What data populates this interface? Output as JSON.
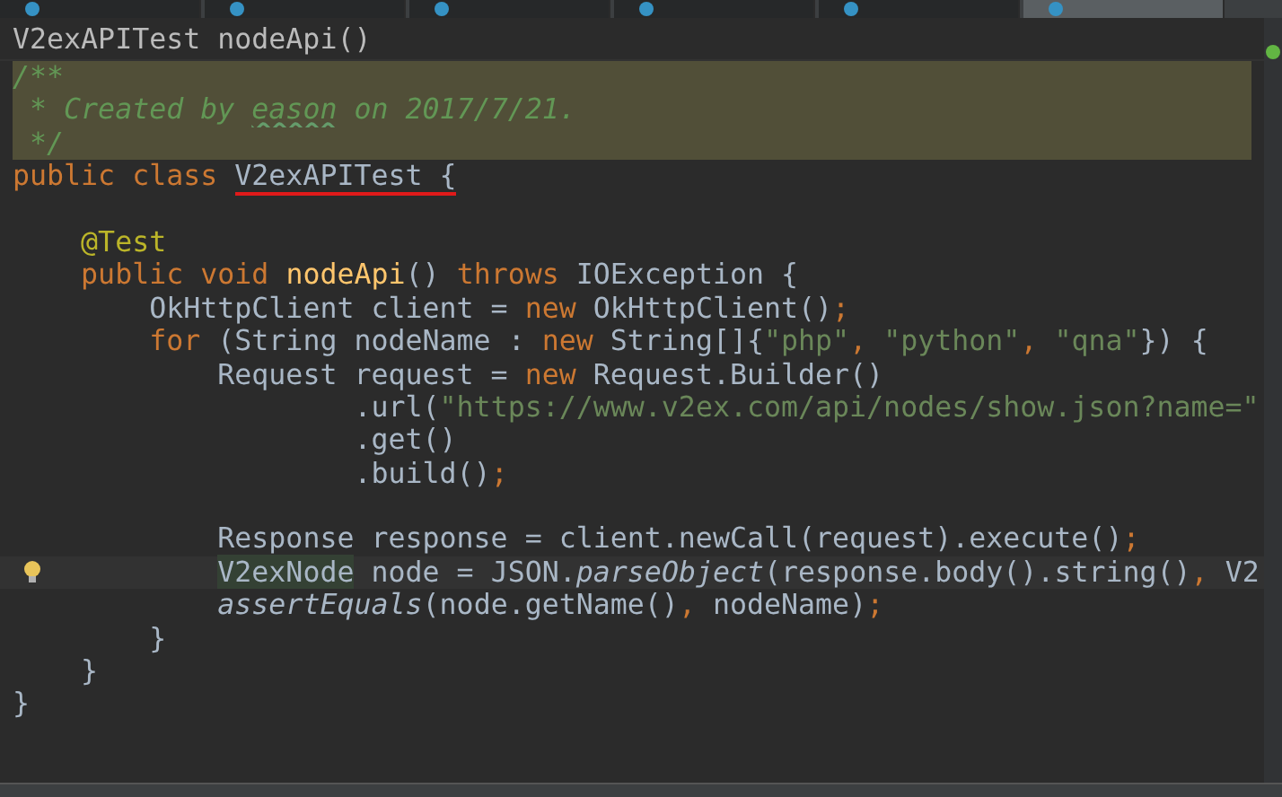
{
  "editor_tabs": [
    {
      "selected": false
    },
    {
      "selected": false
    },
    {
      "selected": false
    },
    {
      "selected": false
    },
    {
      "selected": false
    },
    {
      "selected": true
    }
  ],
  "breadcrumbs": [
    "V2exAPITest",
    "nodeApi()"
  ],
  "code_lines": [
    {
      "block": true,
      "tokens": [
        {
          "kind": "comment",
          "text": "/**"
        }
      ]
    },
    {
      "block": true,
      "tokens": [
        {
          "kind": "comment",
          "text": " * Created by "
        },
        {
          "kind": "comment",
          "text": "eason",
          "typo": true
        },
        {
          "kind": "comment",
          "text": " on 2017/7/21."
        }
      ]
    },
    {
      "block": true,
      "tokens": [
        {
          "kind": "comment",
          "text": " */"
        }
      ]
    },
    {
      "tokens": [
        {
          "kind": "keyword",
          "text": "public class "
        },
        {
          "kind": "plain",
          "text": "V2exAPITest {",
          "marked": true
        }
      ]
    },
    {
      "kind": "blank"
    },
    {
      "tokens": [
        {
          "kind": "annotation",
          "text": "    @Test"
        }
      ]
    },
    {
      "tokens": [
        {
          "kind": "keyword",
          "text": "    public void "
        },
        {
          "kind": "method",
          "text": "nodeApi"
        },
        {
          "kind": "plain",
          "text": "() "
        },
        {
          "kind": "keyword",
          "text": "throws "
        },
        {
          "kind": "plain",
          "text": "IOException {"
        }
      ]
    },
    {
      "tokens": [
        {
          "kind": "plain",
          "text": "        OkHttpClient client = "
        },
        {
          "kind": "keyword",
          "text": "new "
        },
        {
          "kind": "plain",
          "text": "OkHttpClient()"
        },
        {
          "kind": "keyword",
          "text": ";"
        }
      ]
    },
    {
      "tokens": [
        {
          "kind": "keyword",
          "text": "        for "
        },
        {
          "kind": "plain",
          "text": "(String nodeName : "
        },
        {
          "kind": "keyword",
          "text": "new "
        },
        {
          "kind": "plain",
          "text": "String[]{"
        },
        {
          "kind": "string",
          "text": "\"php\""
        },
        {
          "kind": "keyword",
          "text": ", "
        },
        {
          "kind": "string",
          "text": "\"python\""
        },
        {
          "kind": "keyword",
          "text": ", "
        },
        {
          "kind": "string",
          "text": "\"qna\""
        },
        {
          "kind": "plain",
          "text": "}) {"
        }
      ]
    },
    {
      "tokens": [
        {
          "kind": "plain",
          "text": "            Request request = "
        },
        {
          "kind": "keyword",
          "text": "new "
        },
        {
          "kind": "plain",
          "text": "Request.Builder()"
        }
      ]
    },
    {
      "tokens": [
        {
          "kind": "plain",
          "text": "                    .url("
        },
        {
          "kind": "string",
          "text": "\"https://www.v2ex.com/api/nodes/show.json?name=\""
        }
      ]
    },
    {
      "tokens": [
        {
          "kind": "plain",
          "text": "                    .get()"
        }
      ]
    },
    {
      "tokens": [
        {
          "kind": "plain",
          "text": "                    .build()"
        },
        {
          "kind": "keyword",
          "text": ";"
        }
      ]
    },
    {
      "kind": "blank"
    },
    {
      "tokens": [
        {
          "kind": "plain",
          "text": "            Response response = client.newCall(request).execute()"
        },
        {
          "kind": "keyword",
          "text": ";"
        }
      ]
    },
    {
      "bulb": true,
      "current": true,
      "tokens": [
        {
          "kind": "plain",
          "text": "            V2exNode",
          "highlight": true
        },
        {
          "kind": "plain",
          "text": " node = JSON."
        },
        {
          "kind": "static",
          "text": "parseObject"
        },
        {
          "kind": "plain",
          "text": "(response.body().string()"
        },
        {
          "kind": "keyword",
          "text": ", "
        },
        {
          "kind": "plain",
          "text": "V2"
        }
      ]
    },
    {
      "tokens": [
        {
          "kind": "static",
          "text": "            assertEquals"
        },
        {
          "kind": "plain",
          "text": "(node.getName()"
        },
        {
          "kind": "keyword",
          "text": ", "
        },
        {
          "kind": "plain",
          "text": "nodeName)"
        },
        {
          "kind": "keyword",
          "text": ";"
        }
      ]
    },
    {
      "tokens": [
        {
          "kind": "plain",
          "text": "        }"
        }
      ]
    },
    {
      "tokens": [
        {
          "kind": "plain",
          "text": "    }"
        }
      ]
    },
    {
      "tokens": [
        {
          "kind": "plain",
          "text": "}"
        }
      ]
    }
  ]
}
